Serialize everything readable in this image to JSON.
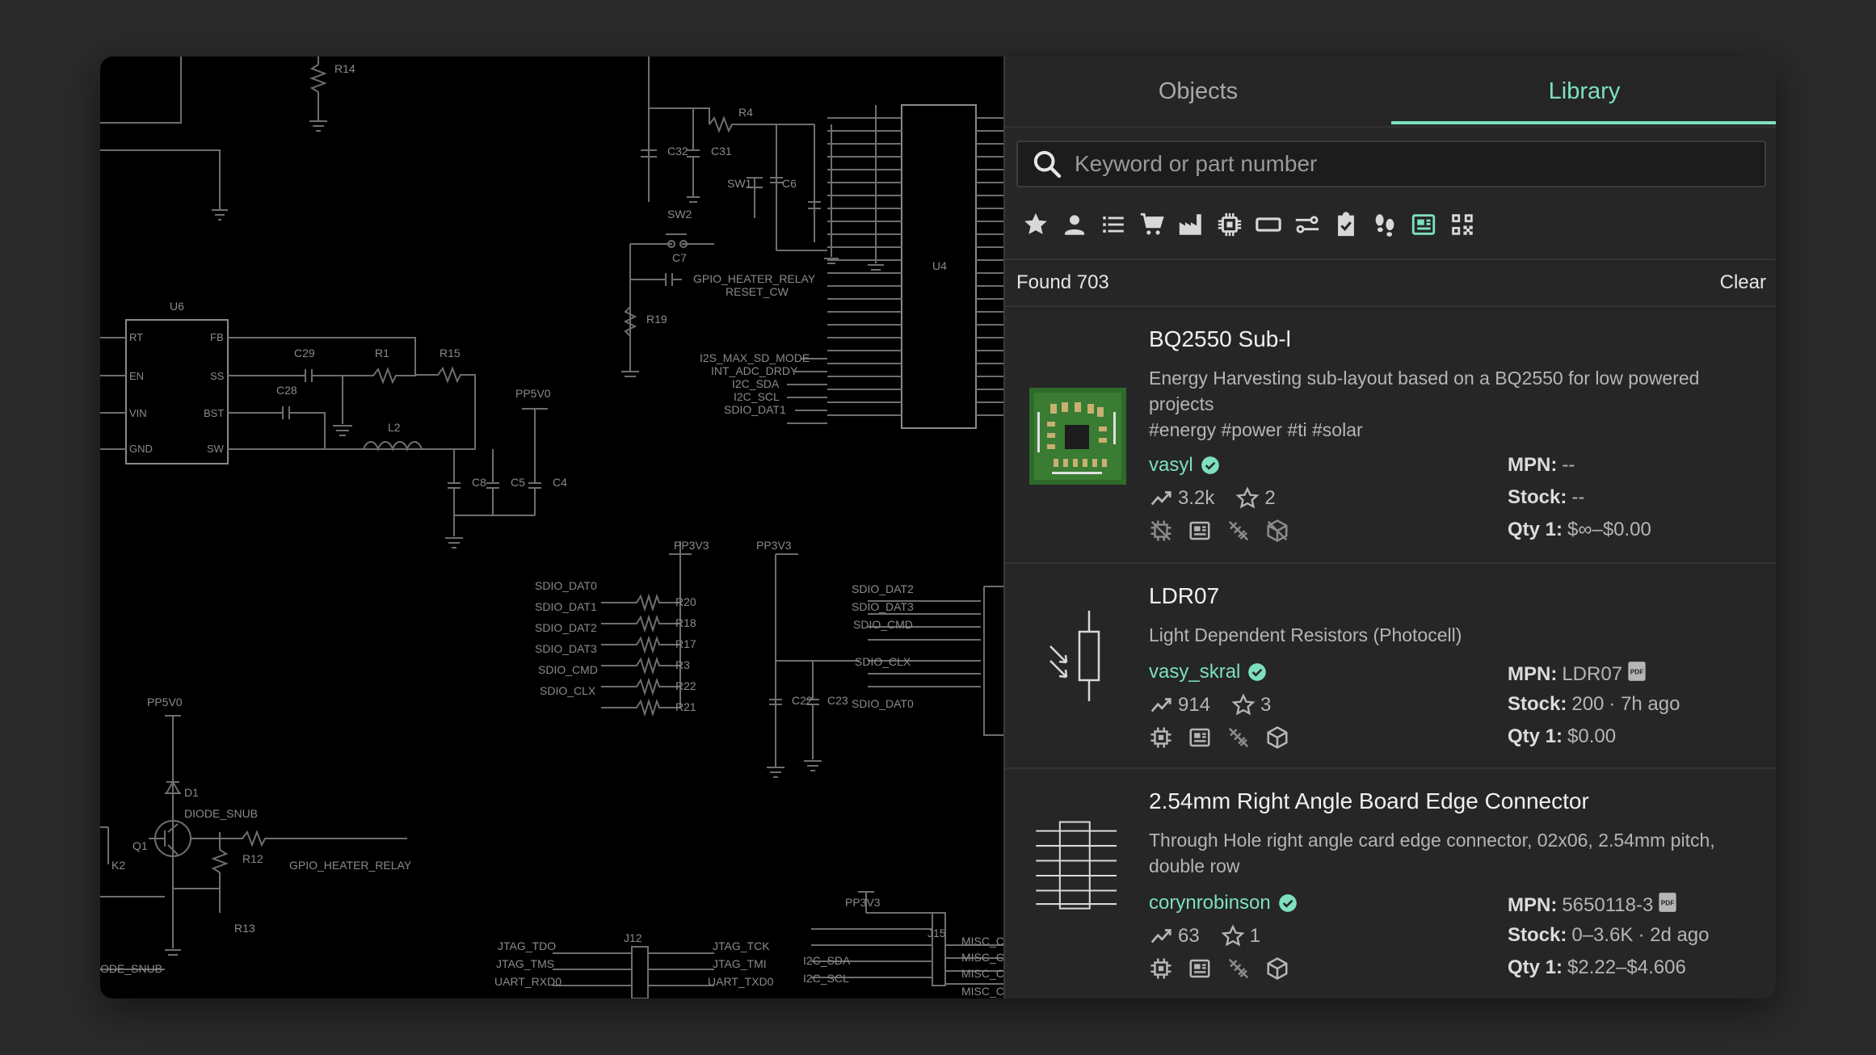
{
  "tabs": {
    "objects": "Objects",
    "library": "Library"
  },
  "search": {
    "placeholder": "Keyword or part number"
  },
  "filters": [
    "star-icon",
    "user-icon",
    "list-icon",
    "cart-icon",
    "factory-icon",
    "chip-icon",
    "footprint-icon",
    "switch-icon",
    "checked-icon",
    "footsteps-icon",
    "board-icon",
    "qrcode-icon"
  ],
  "results": {
    "found": "Found 703",
    "clear": "Clear"
  },
  "parts": [
    {
      "title": "BQ2550 Sub-l",
      "description": "Energy Harvesting sub-layout based on a BQ2550 for low powered projects",
      "tags": "#energy #power #ti #solar",
      "owner": "vasyl",
      "views": "3.2k",
      "stars": "2",
      "mpn_label": "MPN:",
      "mpn": "--",
      "stock_label": "Stock:",
      "stock": "--",
      "stock_time": "",
      "qty_label": "Qty 1:",
      "qty": "$∞–$0.00"
    },
    {
      "title": "LDR07",
      "description": "Light Dependent Resistors (Photocell)",
      "tags": "",
      "owner": "vasy_skral",
      "views": "914",
      "stars": "3",
      "mpn_label": "MPN:",
      "mpn": "LDR07",
      "stock_label": "Stock:",
      "stock": "200",
      "stock_time": "· 7h ago",
      "qty_label": "Qty 1:",
      "qty": "$0.00"
    },
    {
      "title": "2.54mm Right Angle Board Edge Connector",
      "description": "Through Hole right angle card edge connector, 02x06, 2.54mm pitch, double row",
      "tags": "",
      "owner": "corynrobinson",
      "views": "63",
      "stars": "1",
      "mpn_label": "MPN:",
      "mpn": "5650118-3",
      "stock_label": "Stock:",
      "stock": "0–3.6K",
      "stock_time": "· 2d ago",
      "qty_label": "Qty 1:",
      "qty": "$2.22–$4.606"
    }
  ],
  "schematic": {
    "designators": [
      "R14",
      "R4",
      "C32",
      "C31",
      "SW1",
      "C6",
      "SW2",
      "C7",
      "U4",
      "U6",
      "C29",
      "R1",
      "R15",
      "C28",
      "L2",
      "R19",
      "C8",
      "C5",
      "C4",
      "PP5V0",
      "PP3V3",
      "PP3V3",
      "R20",
      "R18",
      "R17",
      "R3",
      "R22",
      "R21",
      "C22",
      "C23",
      "PP5V0",
      "D1",
      "Q1",
      "R12",
      "R13",
      "K2",
      "J12",
      "J15",
      "PP3V3"
    ],
    "u6_pins": [
      "RT",
      "FB",
      "EN",
      "SS",
      "VIN",
      "BST",
      "GND",
      "SW"
    ],
    "nets": [
      "GPIO_HEATER_RELAY",
      "RESET_CW",
      "I2S_MAX_SD_MODE",
      "INT_ADC_DRDY",
      "I2C_SDA",
      "I2C_SCL",
      "SDIO_DAT1",
      "SDIO_DAT0",
      "SDIO_DAT1",
      "SDIO_DAT2",
      "SDIO_DAT3",
      "SDIO_CMD",
      "SDIO_CLX",
      "SDIO_DAT2",
      "SDIO_DAT3",
      "SDIO_CMD",
      "SDIO_CLX",
      "SDIO_DAT0",
      "DIODE_SNUB",
      "GPIO_HEATER_RELAY",
      "ODE_SNUB",
      "JTAG_TDO",
      "JTAG_TMS",
      "UART_RXD0",
      "JTAG_TCK",
      "JTAG_TMI",
      "UART_TXD0",
      "I2C_SDA",
      "I2C_SCL",
      "MISC_C",
      "MISC_C",
      "MISC_C",
      "MISC_C"
    ]
  }
}
